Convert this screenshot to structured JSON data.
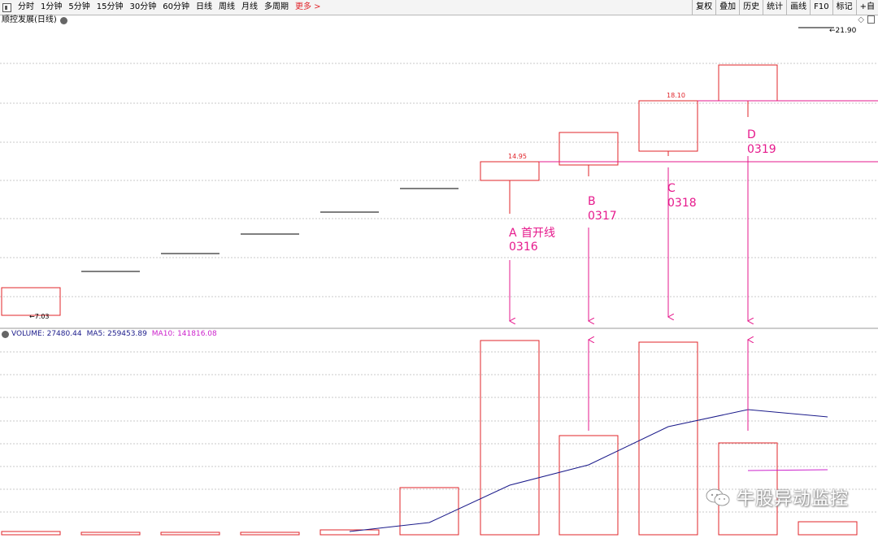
{
  "toolbar": {
    "periods": [
      "分时",
      "1分钟",
      "5分钟",
      "15分钟",
      "30分钟",
      "60分钟",
      "日线",
      "周线",
      "月线",
      "多周期"
    ],
    "more": "更多 >",
    "right_buttons": [
      "复权",
      "叠加",
      "历史",
      "统计",
      "画线",
      "F10",
      "标记",
      "+自"
    ]
  },
  "chart": {
    "title": "顺控发展(日线)",
    "price_max_label": "21.90",
    "price_min_label": "7.03",
    "label_14_95": "14.95",
    "label_18_10": "18.10",
    "annotations": {
      "A_letter": "A",
      "A_text": "首开线",
      "A_date": "0316",
      "B_letter": "B",
      "B_date": "0317",
      "C_letter": "C",
      "C_date": "0318",
      "D_letter": "D",
      "D_date": "0319"
    },
    "colors": {
      "up": "#e0242a",
      "flat": "#333333",
      "annotation": "#e6198c",
      "ma5": "#1a1a8a",
      "ma10": "#cc22cc",
      "grid": "#c8c8c8"
    }
  },
  "volume": {
    "label": "VOLUME:",
    "value": "27480.44",
    "ma5_label": "MA5:",
    "ma5_value": "259453.89",
    "ma10_label": "MA10:",
    "ma10_value": "141816.08"
  },
  "watermark": "牛股异动监控"
}
